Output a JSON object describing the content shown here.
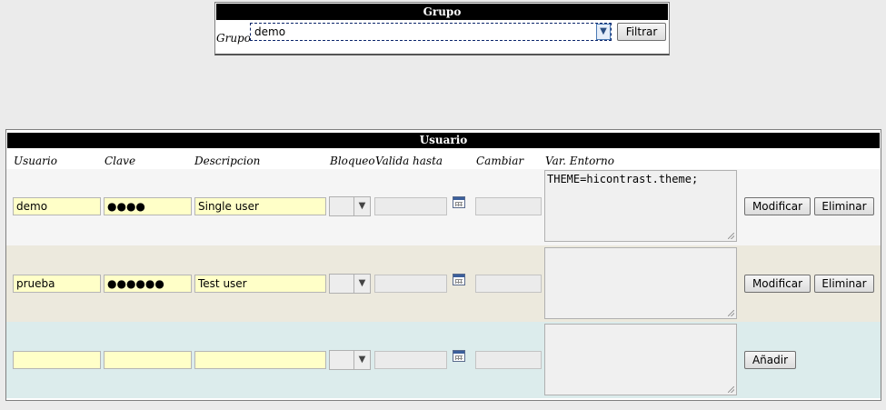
{
  "grupo": {
    "header": "Grupo",
    "label": "Grupo",
    "selected": "demo",
    "filter_button": "Filtrar"
  },
  "usuario": {
    "header": "Usuario",
    "columns": {
      "usuario": "Usuario",
      "clave": "Clave",
      "descripcion": "Descripcion",
      "bloqueo": "Bloqueo",
      "valida_hasta": "Valida hasta",
      "cambiar": "Cambiar",
      "var_entorno": "Var. Entorno"
    },
    "rows": [
      {
        "usuario": "demo",
        "clave": "●●●●",
        "descripcion": "Single user",
        "var_entorno": "THEME=hicontrast.theme;",
        "modify": "Modificar",
        "delete": "Eliminar"
      },
      {
        "usuario": "prueba",
        "clave": "●●●●●●",
        "descripcion": "Test user",
        "var_entorno": "",
        "modify": "Modificar",
        "delete": "Eliminar"
      }
    ],
    "new_row": {
      "add": "Añadir"
    }
  },
  "icons": {
    "dropdown": "chevron-down-icon",
    "calendar": "calendar-icon",
    "resize": "resize-grip-icon"
  },
  "colors": {
    "header_bg": "#000000",
    "input_bg": "#ffffc8",
    "row1_bg": "#f5f5f5",
    "row2_bg": "#ece9dd",
    "row3_bg": "#dcecec"
  }
}
